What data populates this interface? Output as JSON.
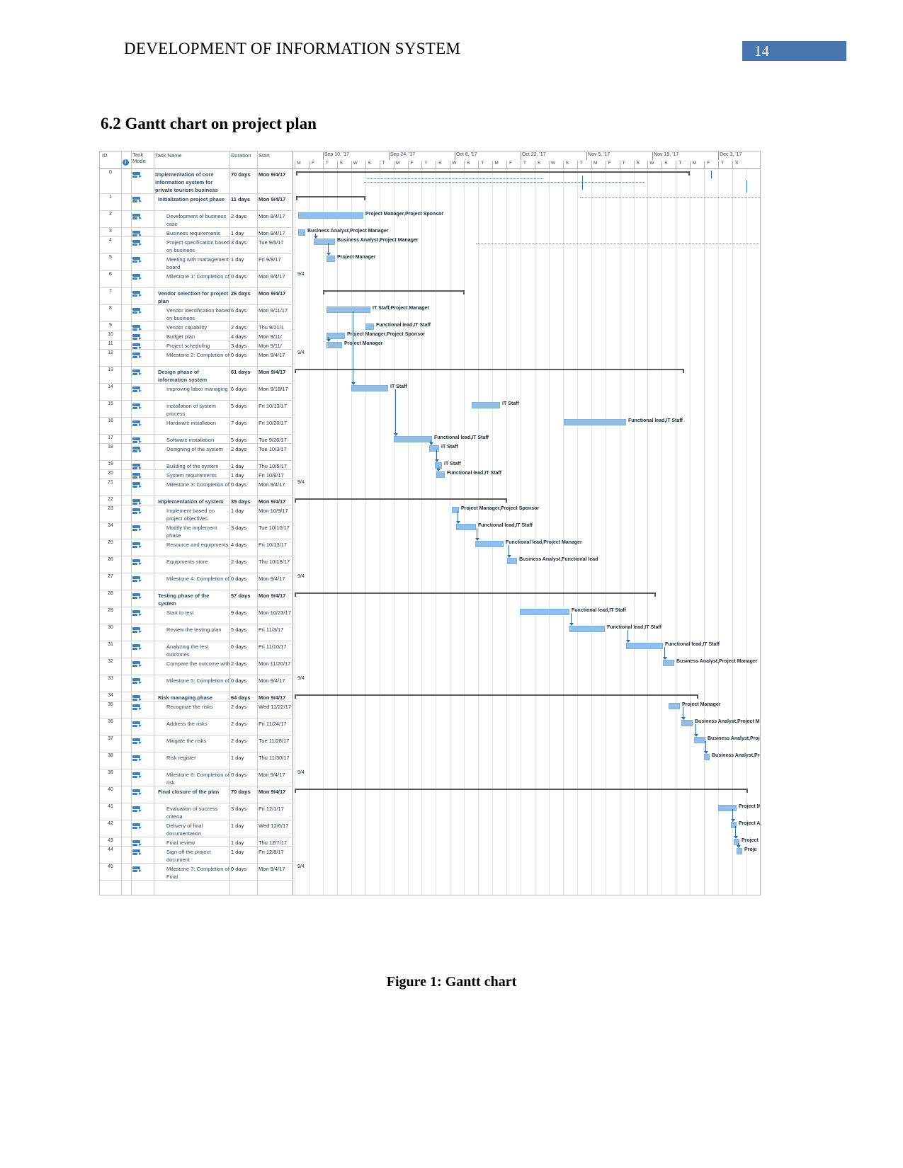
{
  "header": {
    "document_title": "DEVELOPMENT OF INFORMATION SYSTEM",
    "page_number": "14"
  },
  "section": {
    "heading": "6.2 Gantt chart on project plan"
  },
  "caption": "Figure 1: Gantt chart",
  "chart_data": {
    "type": "bar",
    "title": "Gantt chart",
    "xlabel": "",
    "ylabel": "",
    "columns": [
      "ID",
      "",
      "Task Mode",
      "Task Name",
      "Duration",
      "Start"
    ],
    "timeline": {
      "week_labels": [
        "Sep 10, '17",
        "Sep 24, '17",
        "Oct 8, '17",
        "Oct 22, '17",
        "Nov 5, '17",
        "Nov 19, '17",
        "Dec 3, '17"
      ],
      "day_labels": [
        "M",
        "F",
        "T",
        "S",
        "W",
        "S",
        "T",
        "M",
        "F",
        "T",
        "S",
        "W",
        "S",
        "T",
        "M",
        "F",
        "T",
        "S",
        "W",
        "S",
        "T",
        "M",
        "F",
        "T",
        "S",
        "W",
        "S",
        "T",
        "M",
        "F",
        "T",
        "S"
      ],
      "today_marker": "9/4"
    },
    "tasks": [
      {
        "id": "0",
        "level": 0,
        "name": "Implementation of core information system for private tourism business",
        "duration": "70 days",
        "start": "Mon 9/4/17",
        "kind": "summary",
        "resources": ""
      },
      {
        "id": "1",
        "level": 1,
        "name": "Initialization project phase",
        "duration": "11 days",
        "start": "Mon 9/4/17",
        "kind": "summary",
        "resources": ""
      },
      {
        "id": "2",
        "level": 2,
        "name": "Development of business case",
        "duration": "2 days",
        "start": "Mon 9/4/17",
        "kind": "task",
        "resources": "Project Manager,Project Sponsor"
      },
      {
        "id": "3",
        "level": 2,
        "name": "Business requirements",
        "duration": "1 day",
        "start": "Mon 9/4/17",
        "kind": "task",
        "resources": "Business Analyst,Project Manager"
      },
      {
        "id": "4",
        "level": 2,
        "name": "Project specification based on business",
        "duration": "3 days",
        "start": "Tue 9/5/17",
        "kind": "task",
        "resources": "Business Analyst,Project Manager"
      },
      {
        "id": "5",
        "level": 2,
        "name": "Meeting with management board",
        "duration": "1 day",
        "start": "Fri 9/8/17",
        "kind": "task",
        "resources": "Project Manager"
      },
      {
        "id": "6",
        "level": 2,
        "name": "Milestone 1: Completion of",
        "duration": "0 days",
        "start": "Mon 9/4/17",
        "kind": "milestone",
        "resources": "9/4"
      },
      {
        "id": "7",
        "level": 1,
        "name": "Vendor selection for project plan",
        "duration": "26 days",
        "start": "Mon 9/4/17",
        "kind": "summary",
        "resources": ""
      },
      {
        "id": "8",
        "level": 2,
        "name": "Vendor identification based on business",
        "duration": "6 days",
        "start": "Mon 9/11/17",
        "kind": "task",
        "resources": "IT Staff,Project Manager"
      },
      {
        "id": "9",
        "level": 2,
        "name": "Vendor capability",
        "duration": "2 days",
        "start": "Thu 9/21/1",
        "kind": "task",
        "resources": "Functional lead,IT Staff"
      },
      {
        "id": "10",
        "level": 2,
        "name": "Budget plan",
        "duration": "4 days",
        "start": "Mon 9/11/",
        "kind": "task",
        "resources": "Project Manager,Project Sponsor"
      },
      {
        "id": "11",
        "level": 2,
        "name": "Project scheduling",
        "duration": "3 days",
        "start": "Mon 9/11/",
        "kind": "task",
        "resources": "Project Manager"
      },
      {
        "id": "12",
        "level": 2,
        "name": "Milestone 2: Completion of",
        "duration": "0 days",
        "start": "Mon 9/4/17",
        "kind": "milestone",
        "resources": "9/4"
      },
      {
        "id": "13",
        "level": 1,
        "name": "Design phase of information system",
        "duration": "61 days",
        "start": "Mon 9/4/17",
        "kind": "summary",
        "resources": ""
      },
      {
        "id": "14",
        "level": 2,
        "name": "Improving labor managing",
        "duration": "6 days",
        "start": "Mon 9/18/17",
        "kind": "task",
        "resources": "IT Staff"
      },
      {
        "id": "15",
        "level": 2,
        "name": "Installation of system process",
        "duration": "5 days",
        "start": "Fri 10/13/17",
        "kind": "task",
        "resources": "IT Staff"
      },
      {
        "id": "16",
        "level": 2,
        "name": "Hardware installation",
        "duration": "7 days",
        "start": "Fri 10/20/17",
        "kind": "task",
        "resources": "Functional lead,IT Staff"
      },
      {
        "id": "17",
        "level": 2,
        "name": "Software installation",
        "duration": "5 days",
        "start": "Tue 9/26/17",
        "kind": "task",
        "resources": "Functional lead,IT Staff"
      },
      {
        "id": "18",
        "level": 2,
        "name": "Designing of the system",
        "duration": "2 days",
        "start": "Tue 10/3/17",
        "kind": "task",
        "resources": "IT Staff"
      },
      {
        "id": "19",
        "level": 2,
        "name": "Building of the system",
        "duration": "1 day",
        "start": "Thu 10/5/17",
        "kind": "task",
        "resources": "IT Staff"
      },
      {
        "id": "20",
        "level": 2,
        "name": "System requirements",
        "duration": "1 day",
        "start": "Fri 10/6/17",
        "kind": "task",
        "resources": "Functional lead,IT Staff"
      },
      {
        "id": "21",
        "level": 2,
        "name": "Milestone 3: Completion of",
        "duration": "0 days",
        "start": "Mon 9/4/17",
        "kind": "milestone",
        "resources": "9/4"
      },
      {
        "id": "22",
        "level": 1,
        "name": "Implementation of system",
        "duration": "35 days",
        "start": "Mon 9/4/17",
        "kind": "summary",
        "resources": ""
      },
      {
        "id": "23",
        "level": 2,
        "name": "Implement based on project objectives",
        "duration": "1 day",
        "start": "Mon 10/9/17",
        "kind": "task",
        "resources": "Project Manager,Project Sponsor"
      },
      {
        "id": "24",
        "level": 2,
        "name": "Modify the implement phase",
        "duration": "3 days",
        "start": "Tue 10/10/17",
        "kind": "task",
        "resources": "Functional lead,IT Staff"
      },
      {
        "id": "25",
        "level": 2,
        "name": "Resource and equipments",
        "duration": "4 days",
        "start": "Fri 10/13/17",
        "kind": "task",
        "resources": "Functional lead,Project Manager"
      },
      {
        "id": "26",
        "level": 2,
        "name": "Equipments store",
        "duration": "2 days",
        "start": "Thu 10/19/17",
        "kind": "task",
        "resources": "Business Analyst,Functional lead"
      },
      {
        "id": "27",
        "level": 2,
        "name": "Milestone 4: Completion of",
        "duration": "0 days",
        "start": "Mon 9/4/17",
        "kind": "milestone",
        "resources": "9/4"
      },
      {
        "id": "28",
        "level": 1,
        "name": "Testing phase of the system",
        "duration": "57 days",
        "start": "Mon 9/4/17",
        "kind": "summary",
        "resources": ""
      },
      {
        "id": "29",
        "level": 2,
        "name": "Start to test",
        "duration": "9 days",
        "start": "Mon 10/23/17",
        "kind": "task",
        "resources": "Functional lead,IT Staff"
      },
      {
        "id": "30",
        "level": 2,
        "name": "Review the testing plan",
        "duration": "5 days",
        "start": "Fri 11/3/17",
        "kind": "task",
        "resources": "Functional lead,IT Staff"
      },
      {
        "id": "31",
        "level": 2,
        "name": "Analyzing the test outcomes",
        "duration": "6 days",
        "start": "Fri 11/10/17",
        "kind": "task",
        "resources": "Functional lead,IT Staff"
      },
      {
        "id": "32",
        "level": 2,
        "name": "Compare the outcome with",
        "duration": "2 days",
        "start": "Mon 11/20/17",
        "kind": "task",
        "resources": "Business Analyst,Project Manager"
      },
      {
        "id": "33",
        "level": 2,
        "name": "Milestone 5: Completion of",
        "duration": "0 days",
        "start": "Mon 9/4/17",
        "kind": "milestone",
        "resources": "9/4"
      },
      {
        "id": "34",
        "level": 1,
        "name": "Risk managing phase",
        "duration": "64 days",
        "start": "Mon 9/4/17",
        "kind": "summary",
        "resources": ""
      },
      {
        "id": "35",
        "level": 2,
        "name": "Recognize the risks",
        "duration": "2 days",
        "start": "Wed 11/22/17",
        "kind": "task",
        "resources": "Project Manager"
      },
      {
        "id": "36",
        "level": 2,
        "name": "Address the risks",
        "duration": "2 days",
        "start": "Fri 11/24/17",
        "kind": "task",
        "resources": "Business Analyst,Project M"
      },
      {
        "id": "37",
        "level": 2,
        "name": "Mitigate the risks",
        "duration": "2 days",
        "start": "Tue 11/28/17",
        "kind": "task",
        "resources": "Business Analyst,Proje"
      },
      {
        "id": "38",
        "level": 2,
        "name": "Risk register",
        "duration": "1 day",
        "start": "Thu 11/30/17",
        "kind": "task",
        "resources": "Business Analyst,Pro"
      },
      {
        "id": "39",
        "level": 2,
        "name": "Milestone 6: Completion of risk",
        "duration": "0 days",
        "start": "Mon 9/4/17",
        "kind": "milestone",
        "resources": "9/4"
      },
      {
        "id": "40",
        "level": 1,
        "name": "Final closure of the plan",
        "duration": "70 days",
        "start": "Mon 9/4/17",
        "kind": "summary",
        "resources": ""
      },
      {
        "id": "41",
        "level": 2,
        "name": "Evaluation of success criteria",
        "duration": "3 days",
        "start": "Fri 12/1/17",
        "kind": "task",
        "resources": "Project Ma"
      },
      {
        "id": "42",
        "level": 2,
        "name": "Delivery of final documentation",
        "duration": "1 day",
        "start": "Wed 12/6/17",
        "kind": "task",
        "resources": "Project A"
      },
      {
        "id": "43",
        "level": 2,
        "name": "Final review",
        "duration": "1 day",
        "start": "Thu 12/7/17",
        "kind": "task",
        "resources": "Project"
      },
      {
        "id": "44",
        "level": 2,
        "name": "Sign off the project document",
        "duration": "1 day",
        "start": "Fri 12/8/17",
        "kind": "task",
        "resources": "Proje"
      },
      {
        "id": "45",
        "level": 2,
        "name": "Milestone 7: Completion of Final",
        "duration": "0 days",
        "start": "Mon 9/4/17",
        "kind": "milestone",
        "resources": "9/4"
      }
    ]
  },
  "colors": {
    "accent": "#4a76b0",
    "bar": "#94bfe3",
    "link": "#2e6da4",
    "summary": "#595959"
  }
}
